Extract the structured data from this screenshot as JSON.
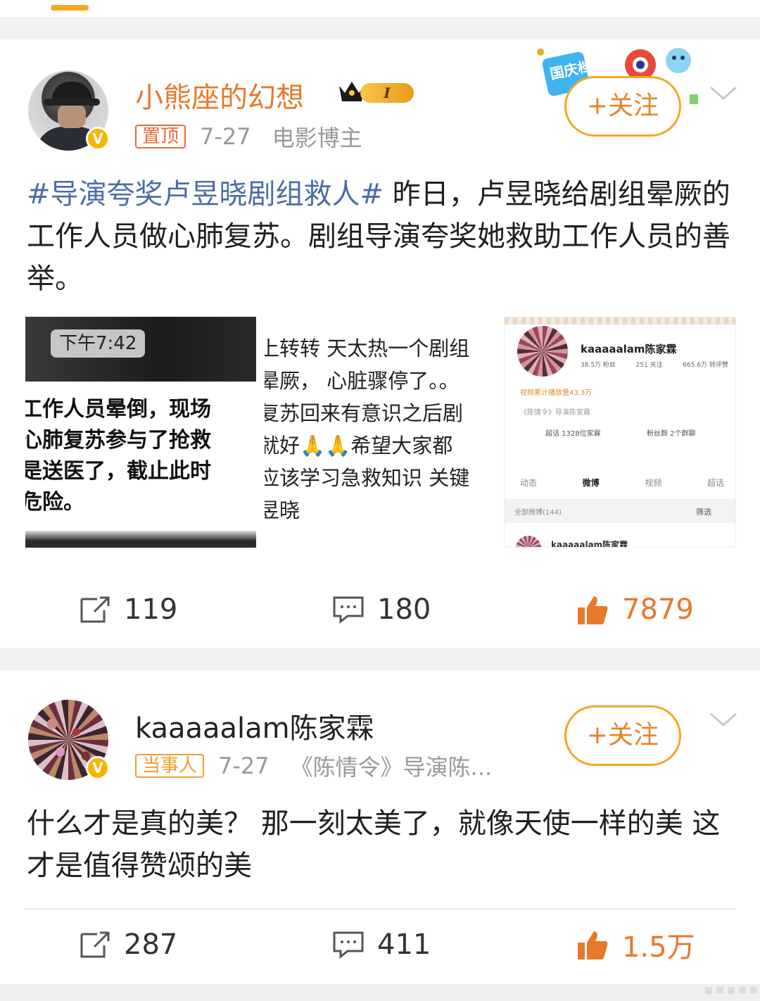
{
  "colors": {
    "accent": "#e8782b",
    "hashtag": "#4b6ea8",
    "gold": "#f5a623",
    "meta": "#999999"
  },
  "posts": [
    {
      "author": "小熊座的幻想",
      "level_badge": "I",
      "tag": "置顶",
      "date": "7-27",
      "source": "电影博主",
      "follow_label": "+关注",
      "follow_decor_text": "国庆档 精彩",
      "hashtag": "#导演夸奖卢昱晓剧组救人#",
      "text": " 昨日，卢昱晓给剧组晕厥的工作人员做心肺复苏。剧组导演夸奖她救助工作人员的善举。",
      "images": {
        "img1": {
          "time": "下午7:42",
          "lines": [
            "工作人员晕倒，现场",
            "心肺复苏参与了抢救",
            "是送医了，截止此时",
            "危险。"
          ]
        },
        "img2": {
          "lines": [
            "上转转 天太热一个剧组",
            "晕厥，  心脏骤停了。。",
            "复苏回来有意识之后剧",
            "就好🙏🙏希望大家都",
            "应该学习急救知识 关键",
            "昱晓"
          ]
        },
        "img3": {
          "name": "kaaaaalam陈家霖",
          "stats": [
            "38.5万 粉丝",
            "251 关注",
            "665.6万 转评赞"
          ],
          "note": "视频累计播放量43.3万",
          "chip": "《陈情令》导演陈家霖",
          "cell_a": "超话 1328位家霖",
          "cell_b": "粉丝群 2个群聊",
          "tabs": [
            "动态",
            "微博",
            "视频",
            "超话"
          ],
          "bar_left": "全部微博(144)",
          "bar_right": "筛选",
          "next_name": "kaaaaalam陈家霖"
        }
      },
      "reposts": "119",
      "comments": "180",
      "likes": "7879"
    },
    {
      "author": "kaaaaalam陈家霖",
      "tag": "当事人",
      "date": "7-27",
      "source": "《陈情令》导演陈...",
      "follow_label": "+关注",
      "text": "什么才是真的美？ 那一刻太美了，就像天使一样的美 这才是值得赞颂的美",
      "reposts": "287",
      "comments": "411",
      "likes": "1.5万"
    }
  ],
  "icons": [
    "repost-icon",
    "comment-icon",
    "like-icon",
    "chevron-down-icon",
    "verified-icon",
    "crown-icon"
  ]
}
